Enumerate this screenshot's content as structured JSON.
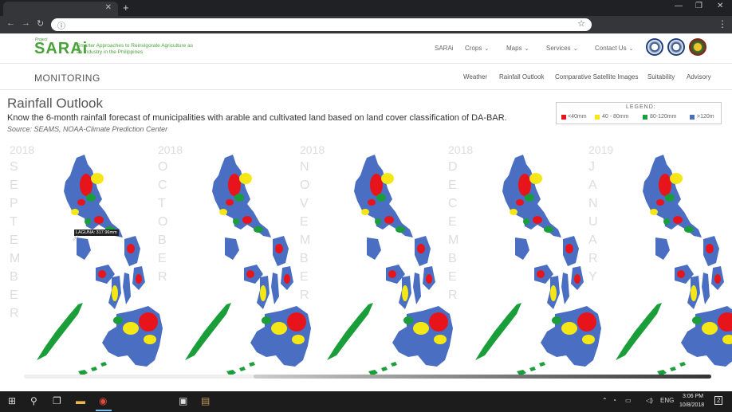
{
  "browser": {
    "tab_title": "",
    "tab_close": "✕",
    "new_tab": "+",
    "win_min": "—",
    "win_max": "❐",
    "win_close": "✕",
    "back": "←",
    "forward": "→",
    "reload": "↻",
    "info": "ⓘ",
    "star": "☆",
    "menu": "⋮"
  },
  "site": {
    "logo_small": "Project",
    "logo": "SARAi",
    "tagline": "Smarter Approaches to Reinvigorate Agriculture as an Industry in the Philippines",
    "nav": [
      {
        "label": "SARAi",
        "caret": ""
      },
      {
        "label": "Crops",
        "caret": "⌄"
      },
      {
        "label": "Maps",
        "caret": "⌄"
      },
      {
        "label": "Services",
        "caret": "⌄"
      },
      {
        "label": "Contact Us",
        "caret": "⌄"
      }
    ],
    "section": "MONITORING",
    "subnav": [
      "Weather",
      "Rainfall Outlook",
      "Comparative Satellite Images",
      "Suitability",
      "Advisory"
    ]
  },
  "content": {
    "title": "Rainfall Outlook",
    "description": "Know the 6-month rainfall forecast of municipalities with arable and cultivated land based on land cover classification of DA-BAR.",
    "source": "Source: SEAMS, NOAA-Climate Prediction Center",
    "legend": {
      "title": "LEGEND:",
      "items": [
        {
          "label": "<40mm",
          "color": "#e8141c"
        },
        {
          "label": "40 - 80mm",
          "color": "#f5e716"
        },
        {
          "label": "80-120mm",
          "color": "#1a9e3a"
        },
        {
          "label": ">120m",
          "color": "#4a6fc2"
        }
      ]
    },
    "maps": [
      {
        "year": "2018",
        "month": [
          "S",
          "E",
          "P",
          "T",
          "E",
          "M",
          "B",
          "E",
          "R"
        ]
      },
      {
        "year": "2018",
        "month": [
          "O",
          "C",
          "T",
          "O",
          "B",
          "E",
          "R"
        ]
      },
      {
        "year": "2018",
        "month": [
          "N",
          "O",
          "V",
          "E",
          "M",
          "B",
          "E",
          "R"
        ]
      },
      {
        "year": "2018",
        "month": [
          "D",
          "E",
          "C",
          "E",
          "M",
          "B",
          "E",
          "R"
        ]
      },
      {
        "year": "2019",
        "month": [
          "J",
          "A",
          "N",
          "U",
          "A",
          "R",
          "Y"
        ]
      }
    ],
    "tooltip": "LAGUNA: 317.96mm"
  },
  "taskbar": {
    "start": "⊞",
    "search": "⚲",
    "taskview": "❐",
    "explorer": "▬",
    "chrome": "◉",
    "app1": "▣",
    "app2": "▤",
    "tray_up": "⌃",
    "tray_net": "◔",
    "tray_bat": "▭",
    "tray_vol": "◁)",
    "lang": "ENG",
    "time": "3:06 PM",
    "date": "10/8/2018",
    "notif": "2"
  }
}
